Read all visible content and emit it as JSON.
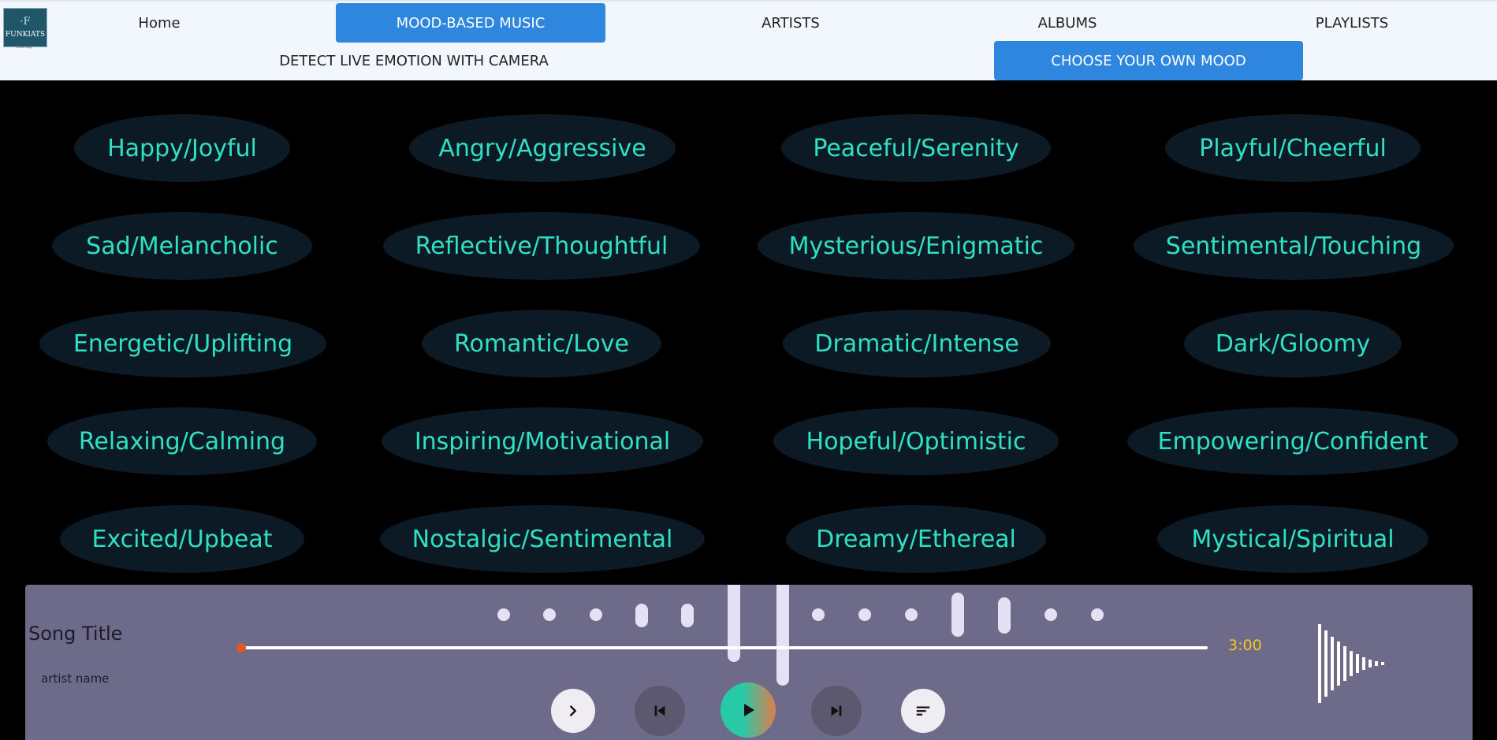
{
  "logo": {
    "mark": "·F",
    "text": "FUNKIATS",
    "subtitle": "Music app"
  },
  "nav": {
    "home": "Home",
    "mood_music": "MOOD-BASED MUSIC",
    "artists": "ARTISTS",
    "albums": "ALBUMS",
    "playlists": "PLAYLISTS",
    "detect_camera": "DETECT LIVE EMOTION WITH CAMERA",
    "choose_mood": "CHOOSE YOUR OWN MOOD"
  },
  "moods": [
    "Happy/Joyful",
    "Angry/Aggressive",
    "Peaceful/Serenity",
    "Playful/Cheerful",
    "Sad/Melancholic",
    "Reflective/Thoughtful",
    "Mysterious/Enigmatic",
    "Sentimental/Touching",
    "Energetic/Uplifting",
    "Romantic/Love",
    "Dramatic/Intense",
    "Dark/Gloomy",
    "Relaxing/Calming",
    "Inspiring/Motivational",
    "Hopeful/Optimistic",
    "Empowering/Confident",
    "Excited/Upbeat",
    "Nostalgic/Sentimental",
    "Dreamy/Ethereal",
    "Mystical/Spiritual"
  ],
  "player": {
    "song_title": "Song Title",
    "artist_name": "artist name",
    "duration": "3:00",
    "progress": 0.0,
    "controls": [
      "chevron-right-icon",
      "skip-previous-icon",
      "play-icon",
      "skip-next-icon",
      "queue-icon"
    ]
  },
  "colors": {
    "nav_bg": "#f1f7fc",
    "accent": "#2e86de",
    "mood_text": "#2fe0c4",
    "mood_bg": "#0c1a26",
    "player_bg": "#6e6b8a",
    "duration": "#f3c81d",
    "thumb": "#e0582a"
  }
}
